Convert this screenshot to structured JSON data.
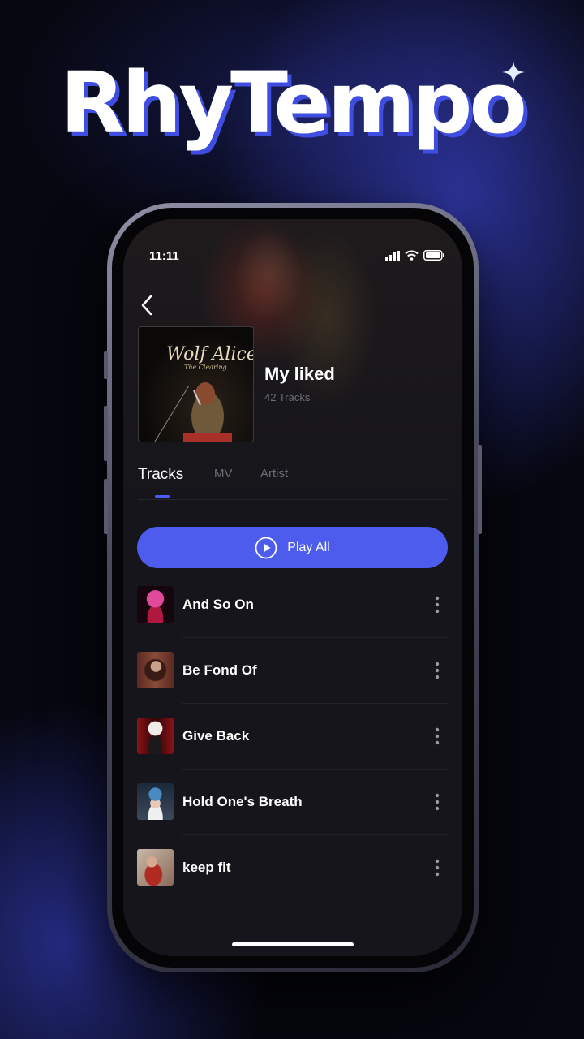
{
  "brand": {
    "title": "RhyTempo"
  },
  "status_bar": {
    "time": "11:11"
  },
  "playlist": {
    "title": "My liked",
    "count": "42 Tracks",
    "cover_art_text": "Wolf Alice"
  },
  "tabs": [
    {
      "label": "Tracks",
      "active": true
    },
    {
      "label": "MV",
      "active": false
    },
    {
      "label": "Artist",
      "active": false
    }
  ],
  "play_all": {
    "label": "Play All"
  },
  "tracks": [
    {
      "title": "And So On"
    },
    {
      "title": "Be Fond Of"
    },
    {
      "title": "Give Back"
    },
    {
      "title": "Hold One's Breath"
    },
    {
      "title": "keep fit"
    }
  ],
  "colors": {
    "accent": "#4d5ced",
    "background": "#15151b",
    "brand_shadow": "#3f4ee0"
  },
  "icons": {
    "back": "chevron-left-icon",
    "play": "play-circle-icon",
    "more": "more-vertical-icon",
    "signal": "signal-icon",
    "wifi": "wifi-icon",
    "battery": "battery-icon"
  }
}
